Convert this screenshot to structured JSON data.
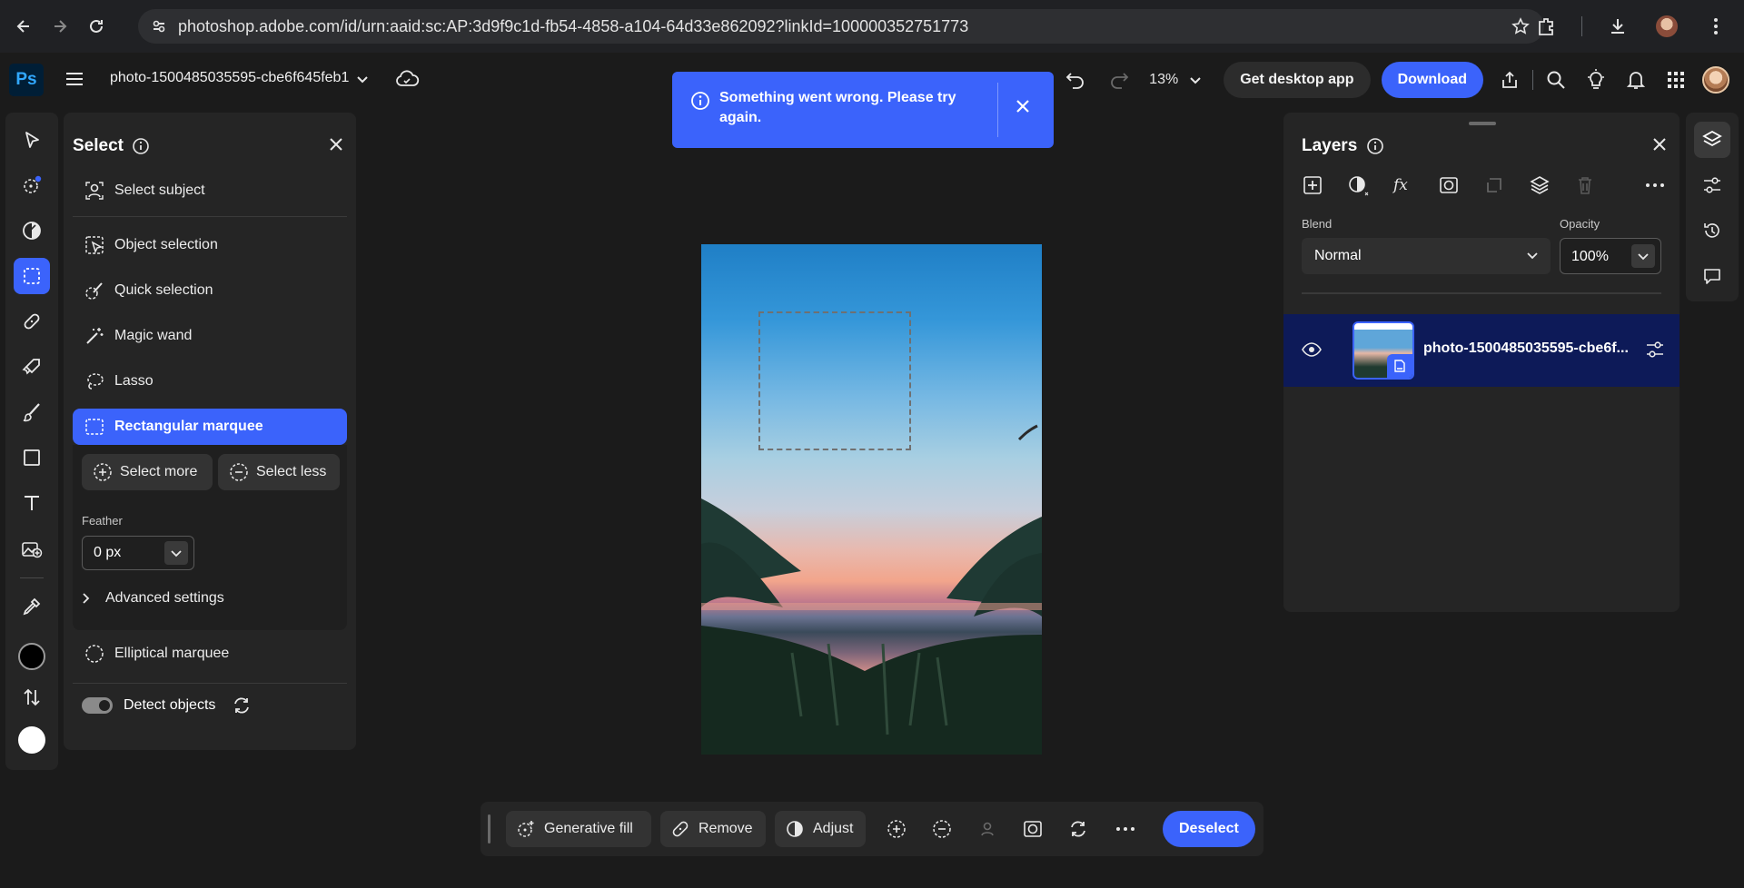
{
  "browser": {
    "url": "photoshop.adobe.com/id/urn:aaid:sc:AP:3d9f9c1d-fb54-4858-a104-64d33e862092?linkId=100000352751773"
  },
  "header": {
    "logo": "Ps",
    "doc_title": "photo-1500485035595-cbe6f645feb1",
    "zoom": "13%",
    "get_desktop_app": "Get desktop app",
    "download": "Download"
  },
  "toast": {
    "message": "Something went wrong. Please try again."
  },
  "select_panel": {
    "title": "Select",
    "items": [
      {
        "label": "Select subject",
        "icon": "select-subject-icon"
      },
      {
        "label": "Object selection",
        "icon": "object-selection-icon"
      },
      {
        "label": "Quick selection",
        "icon": "quick-selection-icon"
      },
      {
        "label": "Magic wand",
        "icon": "magic-wand-icon"
      },
      {
        "label": "Lasso",
        "icon": "lasso-icon"
      },
      {
        "label": "Rectangular marquee",
        "icon": "rect-marquee-icon",
        "active": true
      },
      {
        "label": "Elliptical marquee",
        "icon": "ellipse-marquee-icon"
      }
    ],
    "select_more": "Select more",
    "select_less": "Select less",
    "feather_label": "Feather",
    "feather_value": "0 px",
    "advanced": "Advanced settings",
    "detect_objects": "Detect objects"
  },
  "layers_panel": {
    "title": "Layers",
    "blend_label": "Blend",
    "blend_value": "Normal",
    "opacity_label": "Opacity",
    "opacity_value": "100%",
    "layer_name": "photo-1500485035595-cbe6f..."
  },
  "bottom_bar": {
    "generative_fill": "Generative fill",
    "remove": "Remove",
    "adjust": "Adjust",
    "deselect": "Deselect"
  },
  "colors": {
    "accent": "#3b63fb",
    "panel": "#252525",
    "background": "#1b1b1b",
    "foreground_color": "#000000",
    "background_color": "#ffffff"
  }
}
